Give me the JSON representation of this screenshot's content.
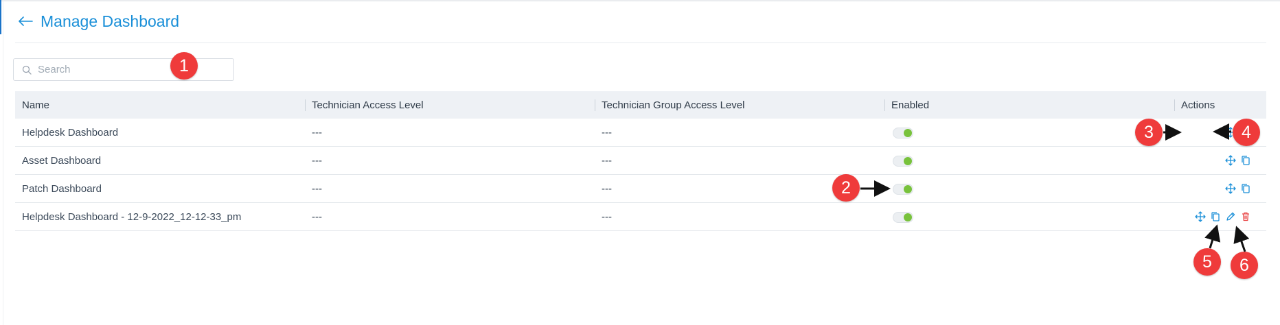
{
  "page": {
    "title": "Manage Dashboard",
    "back_icon": "arrow-left-icon"
  },
  "search": {
    "placeholder": "Search",
    "value": ""
  },
  "table": {
    "columns": [
      "Name",
      "Technician Access Level",
      "Technician Group Access Level",
      "Enabled",
      "Actions"
    ],
    "rows": [
      {
        "name": "Helpdesk Dashboard",
        "technician_access": "---",
        "group_access": "---",
        "enabled": true,
        "actions": [
          "move-icon",
          "copy-icon"
        ]
      },
      {
        "name": "Asset Dashboard",
        "technician_access": "---",
        "group_access": "---",
        "enabled": true,
        "actions": [
          "move-icon",
          "copy-icon"
        ]
      },
      {
        "name": "Patch Dashboard",
        "technician_access": "---",
        "group_access": "---",
        "enabled": true,
        "actions": [
          "move-icon",
          "copy-icon"
        ]
      },
      {
        "name": "Helpdesk Dashboard - 12-9-2022_12-12-33_pm",
        "technician_access": "---",
        "group_access": "---",
        "enabled": true,
        "actions": [
          "move-icon",
          "copy-icon",
          "edit-icon",
          "delete-icon"
        ]
      }
    ]
  },
  "annotations": [
    "1",
    "2",
    "3",
    "4",
    "5",
    "6"
  ],
  "colors": {
    "accent": "#1a8fd8",
    "toggle_on": "#78c23c",
    "delete": "#e94b4b",
    "annotation": "#ef3b3b"
  }
}
